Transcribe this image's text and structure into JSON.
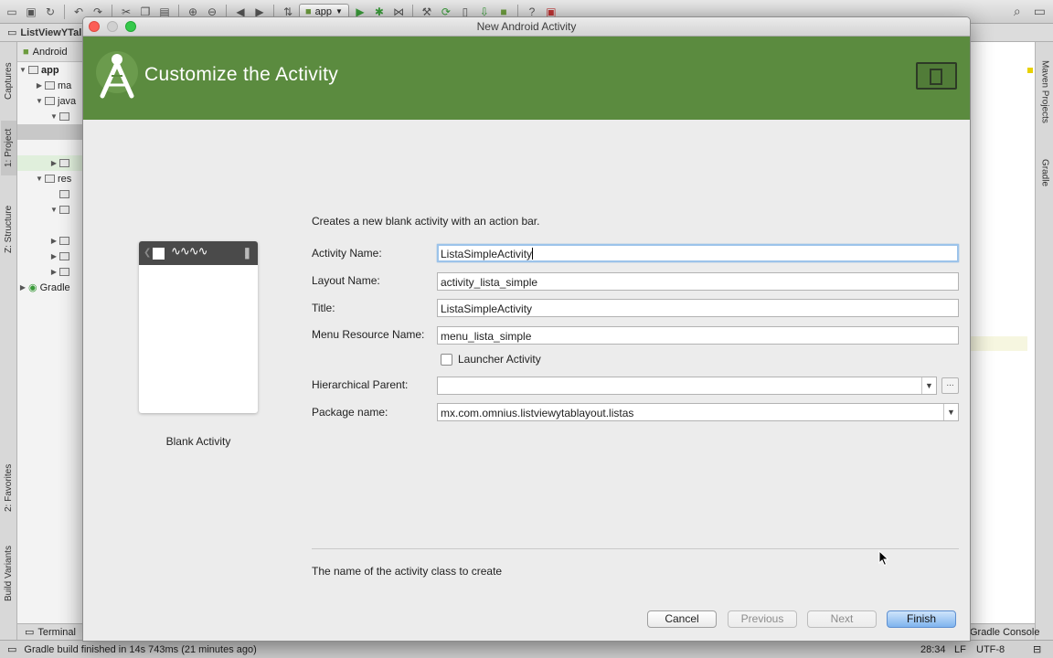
{
  "ide": {
    "toolbar": {
      "run_config": "app"
    },
    "tab_title": "ListViewYTal",
    "left_tabs": [
      "Captures",
      "1: Project",
      "Z: Structure",
      "2: Favorites",
      "Build Variants"
    ],
    "project_header": "Android",
    "tree": [
      {
        "label": "app",
        "twisty": "▼",
        "indent": 0
      },
      {
        "label": "ma",
        "twisty": "▶",
        "indent": 1
      },
      {
        "label": "java",
        "twisty": "▼",
        "indent": 1
      },
      {
        "label": "",
        "twisty": "▼",
        "indent": 2
      },
      {
        "label": "res",
        "twisty": "▼",
        "indent": 1
      },
      {
        "label": "Gradle",
        "twisty": "▶",
        "indent": 0
      }
    ],
    "right_tabs": [
      "Maven Projects",
      "Gradle"
    ],
    "bottom": {
      "terminal": "Terminal",
      "gradle_console": "Gradle Console"
    },
    "status": {
      "message": "Gradle build finished in 14s 743ms (21 minutes ago)",
      "position": "28:34",
      "line_sep": "LF",
      "encoding": "UTF-8"
    }
  },
  "dialog": {
    "window_title": "New Android Activity",
    "banner_title": "Customize the Activity",
    "template_caption": "Blank Activity",
    "description": "Creates a new blank activity with an action bar.",
    "fields": {
      "activity_name": {
        "label": "Activity Name:",
        "value": "ListaSimpleActivity"
      },
      "layout_name": {
        "label": "Layout Name:",
        "value": "activity_lista_simple"
      },
      "title": {
        "label": "Title:",
        "value": "ListaSimpleActivity"
      },
      "menu_resource": {
        "label": "Menu Resource Name:",
        "value": "menu_lista_simple"
      },
      "launcher": {
        "label": "Launcher Activity",
        "checked": false
      },
      "hierarchical_parent": {
        "label": "Hierarchical Parent:",
        "value": ""
      },
      "package_name": {
        "label": "Package name:",
        "value": "mx.com.omnius.listviewytablayout.listas"
      }
    },
    "browse_label": "...",
    "hint": "The name of the activity class to create",
    "buttons": {
      "cancel": "Cancel",
      "previous": "Previous",
      "next": "Next",
      "finish": "Finish"
    }
  },
  "colors": {
    "banner": "#5b8b3f",
    "default_button": "#7fb4ee",
    "focus_ring": "#9cc3ea"
  }
}
